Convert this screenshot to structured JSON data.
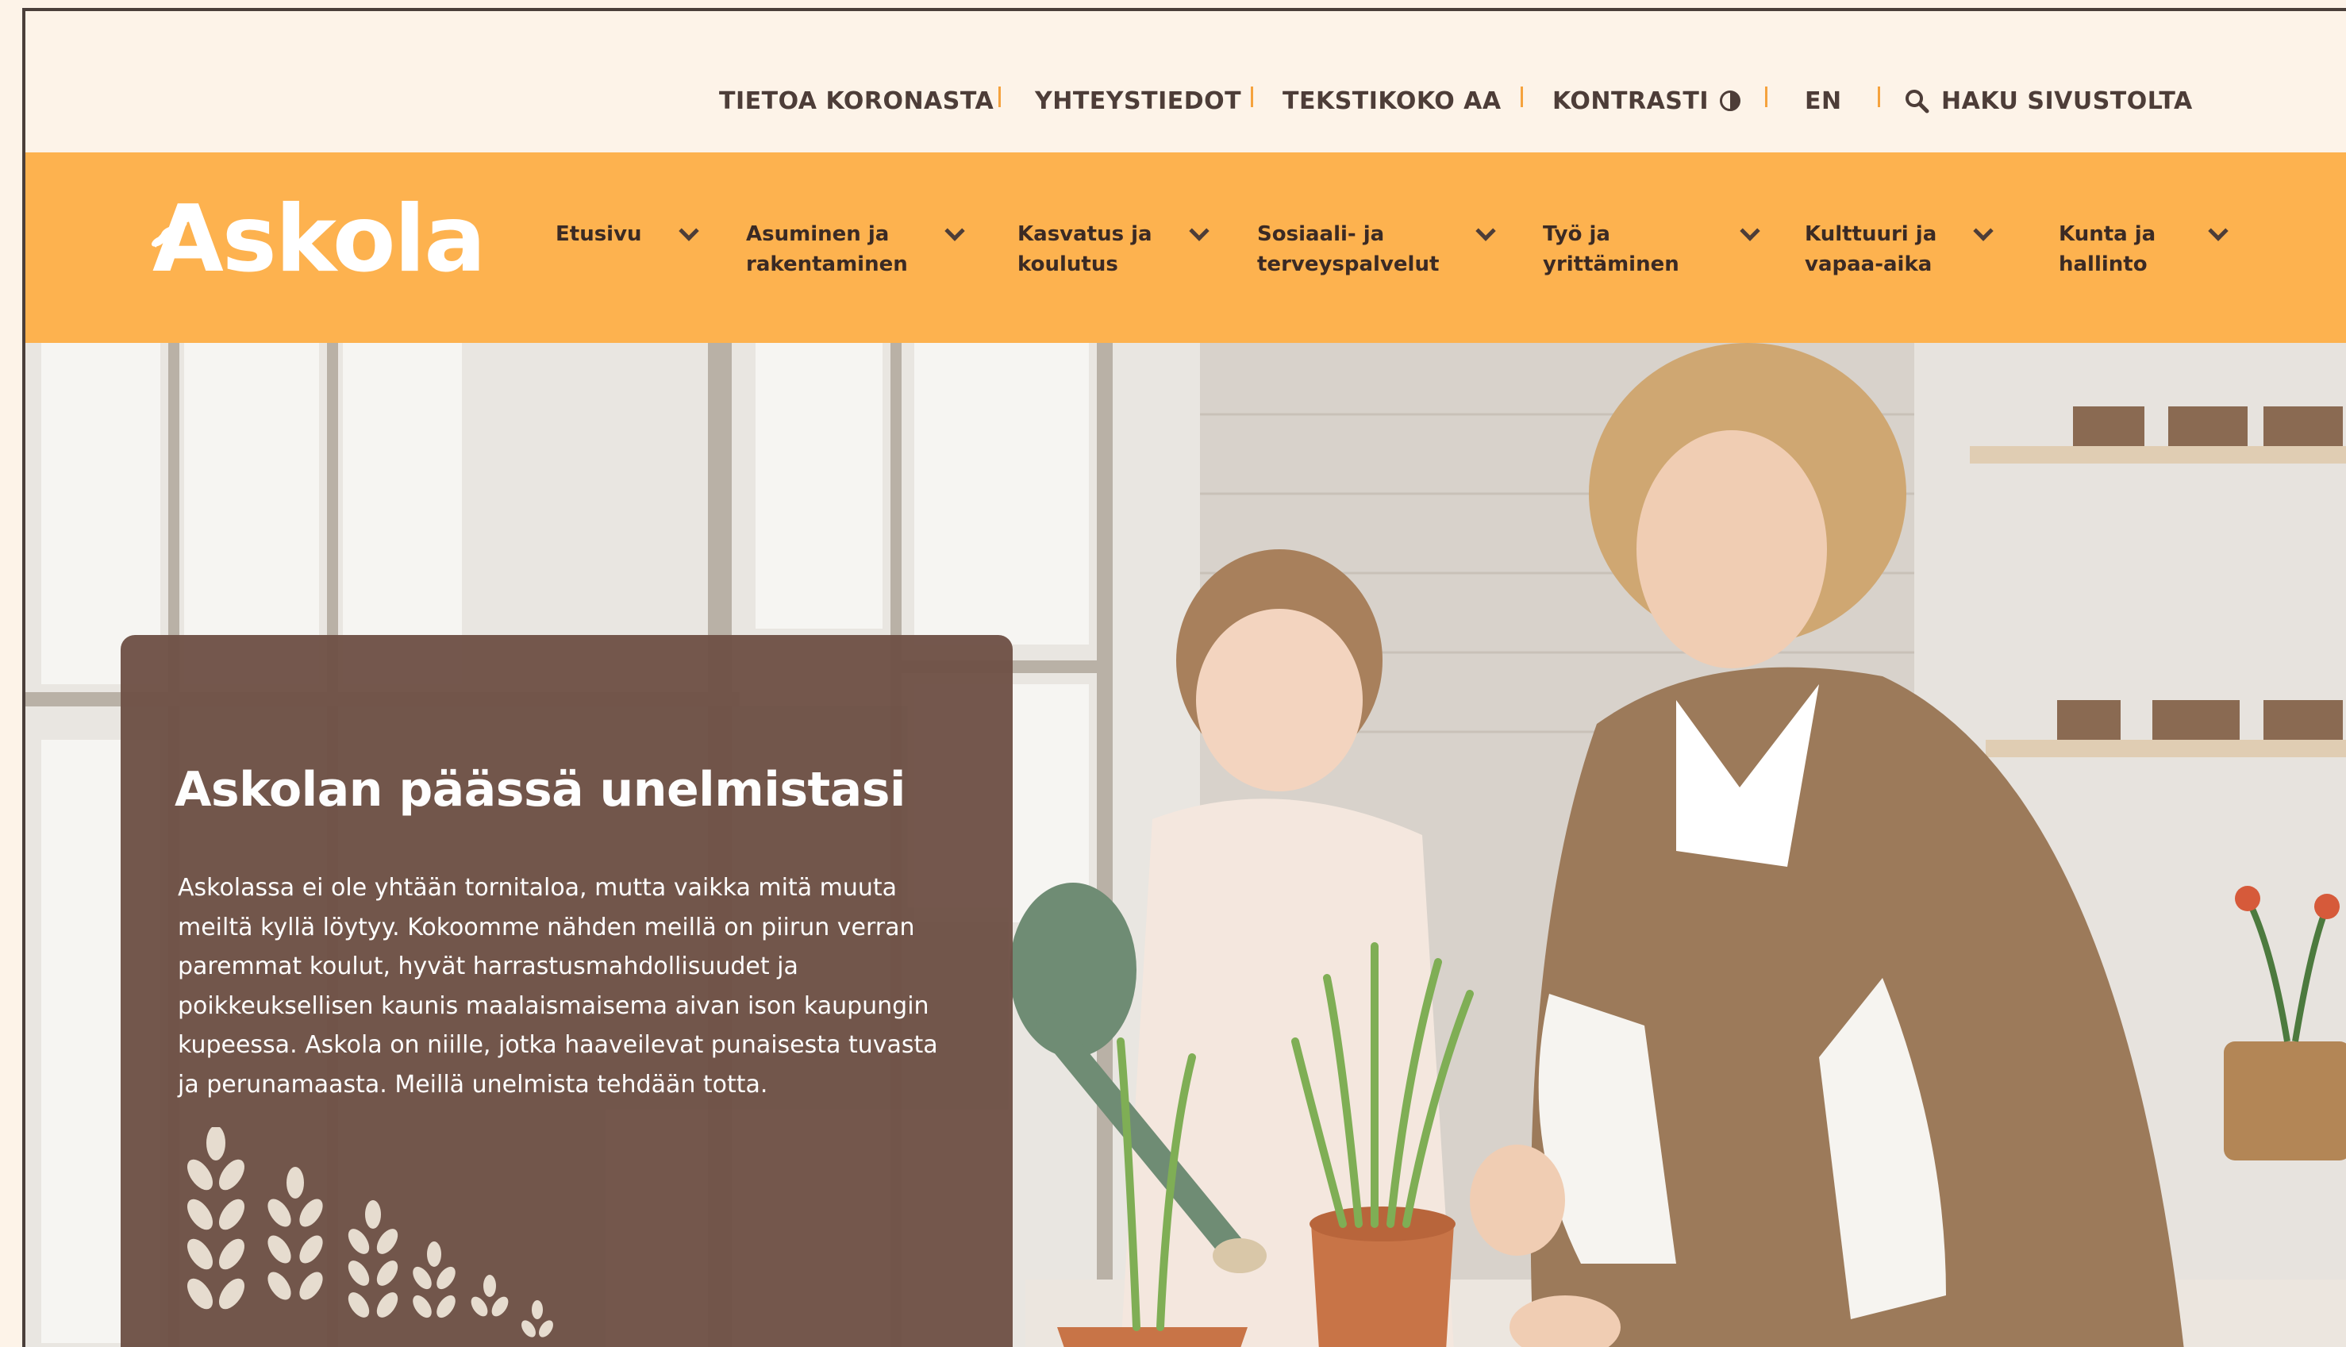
{
  "utility_bar": {
    "items": [
      {
        "label": "TIETOA KORONASTA"
      },
      {
        "label": "YHTEYSTIEDOT"
      },
      {
        "label": "TEKSTIKOKO AA"
      },
      {
        "label": "KONTRASTI"
      },
      {
        "label": "EN"
      },
      {
        "label": "HAKU SIVUSTOLTA"
      }
    ],
    "icons": {
      "contrast": "contrast-icon",
      "search": "search-icon"
    }
  },
  "header": {
    "logo_text": "Askola",
    "nav": [
      {
        "label": "Etusivu"
      },
      {
        "label": "Asuminen ja\nrakentaminen"
      },
      {
        "label": "Kasvatus ja\nkoulutus"
      },
      {
        "label": "Sosiaali- ja\nterveyspalvelut"
      },
      {
        "label": "Työ ja\nyrittäminen"
      },
      {
        "label": "Kulttuuri ja\nvapaa-aika"
      },
      {
        "label": "Kunta ja\nhallinto"
      }
    ]
  },
  "hero": {
    "title": "Askolan päässä unelmistasi",
    "body": "Askolassa ei ole yhtään tornitaloa, mutta vaikka mitä muuta meiltä kyllä löytyy. Kokoomme nähden meillä on piirun verran paremmat koulut, hyvät harrastusmahdollisuudet ja poikkeuksellisen kaunis maalaismaisema aivan ison kaupungin kupeessa. Askola on niille, jotka haaveilevat punaisesta tuvasta ja perunamaasta. Meillä unelmista tehdään totta."
  },
  "colors": {
    "background": "#fdf3e8",
    "nav_orange": "#fdb24f",
    "separator": "#f5a23d",
    "text_dark": "#4d3d38",
    "card_brown": "#6f5247",
    "white": "#ffffff"
  }
}
